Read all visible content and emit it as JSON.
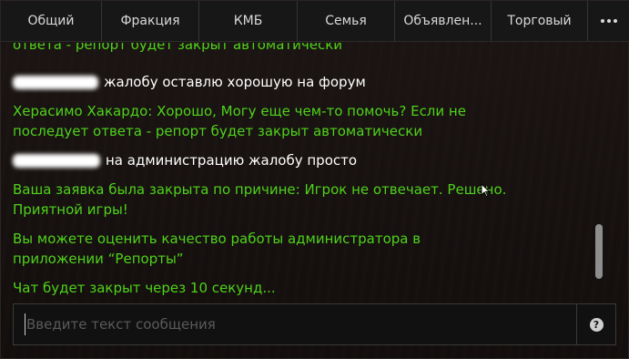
{
  "tabs": [
    {
      "label": "Общий"
    },
    {
      "label": "Фракция"
    },
    {
      "label": "КМБ"
    },
    {
      "label": "Семья"
    },
    {
      "label": "Объявлен..."
    },
    {
      "label": "Торговый"
    }
  ],
  "more_icon": "ellipsis-icon",
  "messages": [
    {
      "text": "ответа - репорт будет закрыт автоматически",
      "color": "#4fd21a"
    },
    {
      "text": "жалобу оставлю хорошую на форум",
      "color": "#ffffff",
      "redacted_sender": true
    },
    {
      "text": "Херасимо Хакардо: Хорошо, Могу еще чем-то помочь? Если не последует ответа - репорт будет закрыт автоматически",
      "color": "#4fd21a"
    },
    {
      "text": "на администрацию жалобу просто",
      "color": "#ffffff",
      "redacted_sender": true
    },
    {
      "text": "Ваша заявка была закрыта по причине: Игрок не отвечает. Решено. Приятной игры!",
      "color": "#4fd21a"
    },
    {
      "text": "Вы можете оценить качество работы администратора в приложении “Репорты”",
      "color": "#4fd21a"
    },
    {
      "text": "Чат будет закрыт через 10 секунд...",
      "color": "#4fd21a"
    }
  ],
  "input": {
    "placeholder": "Введите текст сообщения",
    "value": ""
  },
  "help_icon": "question-icon",
  "help_label": "?"
}
